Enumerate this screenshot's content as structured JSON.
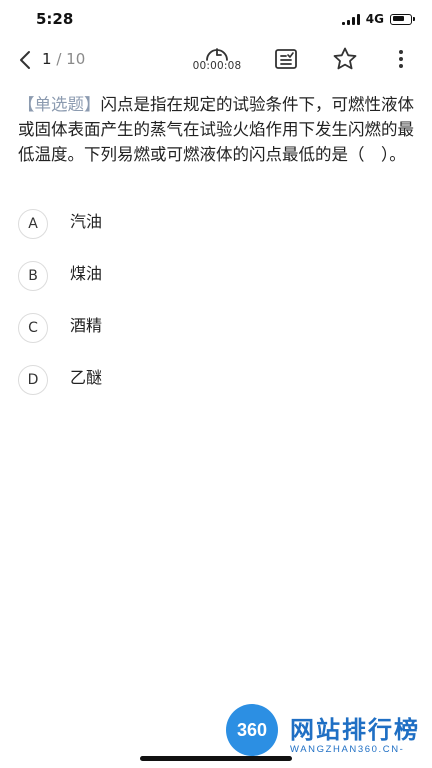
{
  "status_bar": {
    "time": "5:28",
    "network": "4G",
    "battery_level": 0.7
  },
  "nav": {
    "page_current": "1",
    "page_total": "/ 10",
    "timer": "00:00:08",
    "icons": {
      "back": "chevron-left-icon",
      "timer": "clock-icon",
      "answer_sheet": "answer-sheet-icon",
      "favorite": "star-icon",
      "more": "more-vertical-icon"
    }
  },
  "question": {
    "type_label": "【单选题】",
    "text": "闪点是指在规定的试验条件下，可燃性液体或固体表面产生的蒸气在试验火焰作用下发生闪燃的最低温度。下列易燃或可燃液体的闪点最低的是（　）。"
  },
  "options": [
    {
      "letter": "A",
      "text": "汽油"
    },
    {
      "letter": "B",
      "text": "煤油"
    },
    {
      "letter": "C",
      "text": "酒精"
    },
    {
      "letter": "D",
      "text": "乙醚"
    }
  ],
  "watermark": {
    "badge": "360",
    "title": "网站排行榜",
    "subtitle": "WANGZHAN360.CN-"
  },
  "colors": {
    "question_type": "#8c9bb0",
    "watermark_blue": "#2c8fe3"
  }
}
